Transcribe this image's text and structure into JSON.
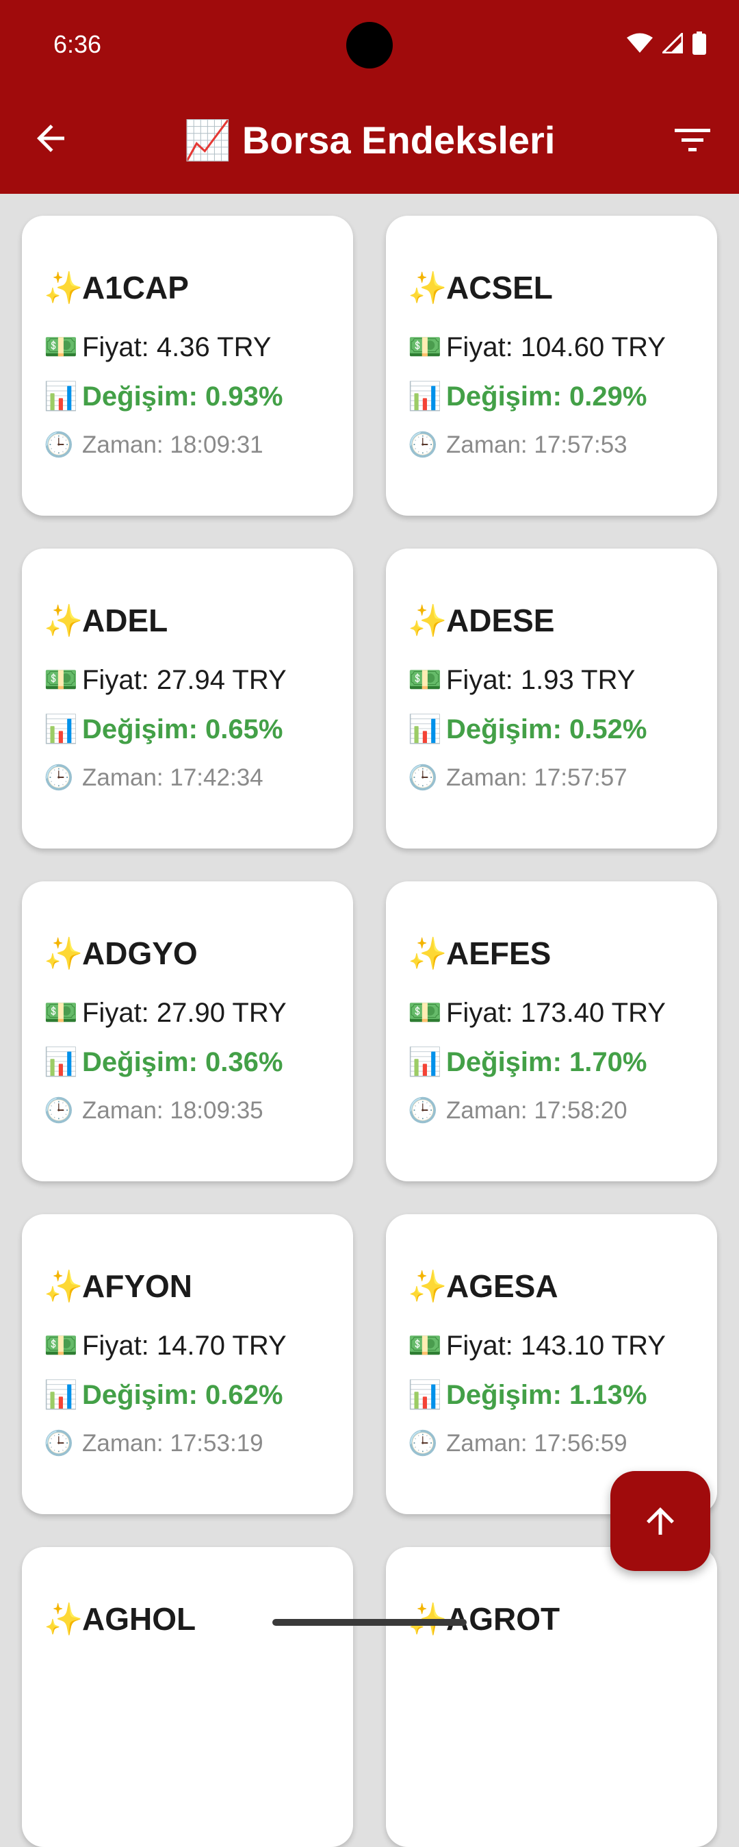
{
  "status_bar": {
    "time": "6:36"
  },
  "app_bar": {
    "title": "📈 Borsa Endeksleri"
  },
  "labels": {
    "sparkle": "✨",
    "money": "💵",
    "chart": "📊",
    "clock": "🕒"
  },
  "stocks": [
    {
      "symbol": "A1CAP",
      "price": "Fiyat: 4.36 TRY",
      "change": "Değişim: 0.93%",
      "time": "Zaman: 18:09:31"
    },
    {
      "symbol": "ACSEL",
      "price": "Fiyat: 104.60 TRY",
      "change": "Değişim: 0.29%",
      "time": "Zaman: 17:57:53"
    },
    {
      "symbol": "ADEL",
      "price": "Fiyat: 27.94 TRY",
      "change": "Değişim: 0.65%",
      "time": "Zaman: 17:42:34"
    },
    {
      "symbol": "ADESE",
      "price": "Fiyat: 1.93 TRY",
      "change": "Değişim: 0.52%",
      "time": "Zaman: 17:57:57"
    },
    {
      "symbol": "ADGYO",
      "price": "Fiyat: 27.90 TRY",
      "change": "Değişim: 0.36%",
      "time": "Zaman: 18:09:35"
    },
    {
      "symbol": "AEFES",
      "price": "Fiyat: 173.40 TRY",
      "change": "Değişim: 1.70%",
      "time": "Zaman: 17:58:20"
    },
    {
      "symbol": "AFYON",
      "price": "Fiyat: 14.70 TRY",
      "change": "Değişim: 0.62%",
      "time": "Zaman: 17:53:19"
    },
    {
      "symbol": "AGESA",
      "price": "Fiyat: 143.10 TRY",
      "change": "Değişim: 1.13%",
      "time": "Zaman: 17:56:59"
    },
    {
      "symbol": "AGHOL",
      "price": "",
      "change": "",
      "time": ""
    },
    {
      "symbol": "AGROT",
      "price": "",
      "change": "",
      "time": ""
    }
  ],
  "icons": {
    "back": "arrow-back-icon",
    "filter": "filter-icon",
    "fab": "arrow-up-icon",
    "wifi": "wifi-icon",
    "signal": "signal-icon",
    "battery": "battery-icon"
  },
  "colors": {
    "primary": "#a00b0c",
    "positive": "#43a047",
    "background": "#e0e0e0"
  }
}
